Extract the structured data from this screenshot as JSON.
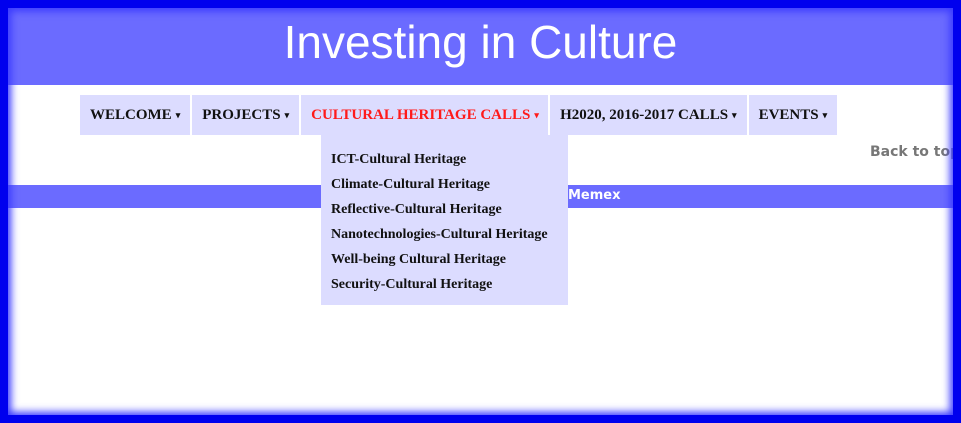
{
  "header": {
    "title": "Investing in Culture"
  },
  "nav": {
    "caret": "▾",
    "items": [
      {
        "label": "WELCOME"
      },
      {
        "label": "PROJECTS"
      },
      {
        "label": "CULTURAL HERITAGE CALLS"
      },
      {
        "label": "H2020, 2016-2017 CALLS"
      },
      {
        "label": "EVENTS"
      }
    ],
    "dropdown": [
      "ICT-Cultural Heritage",
      "Climate-Cultural Heritage",
      "Reflective-Cultural Heritage",
      "Nanotechnologies-Cultural Heritage",
      "Well-being Cultural Heritage",
      "Security-Cultural Heritage"
    ]
  },
  "back_to_top": "Back to top",
  "footer": {
    "text": "Memex"
  },
  "colors": {
    "header_bg": "#6b6bff",
    "nav_bg": "#dcdcff",
    "active_text": "#ff1a1a",
    "frame_border": "#0000ee"
  }
}
